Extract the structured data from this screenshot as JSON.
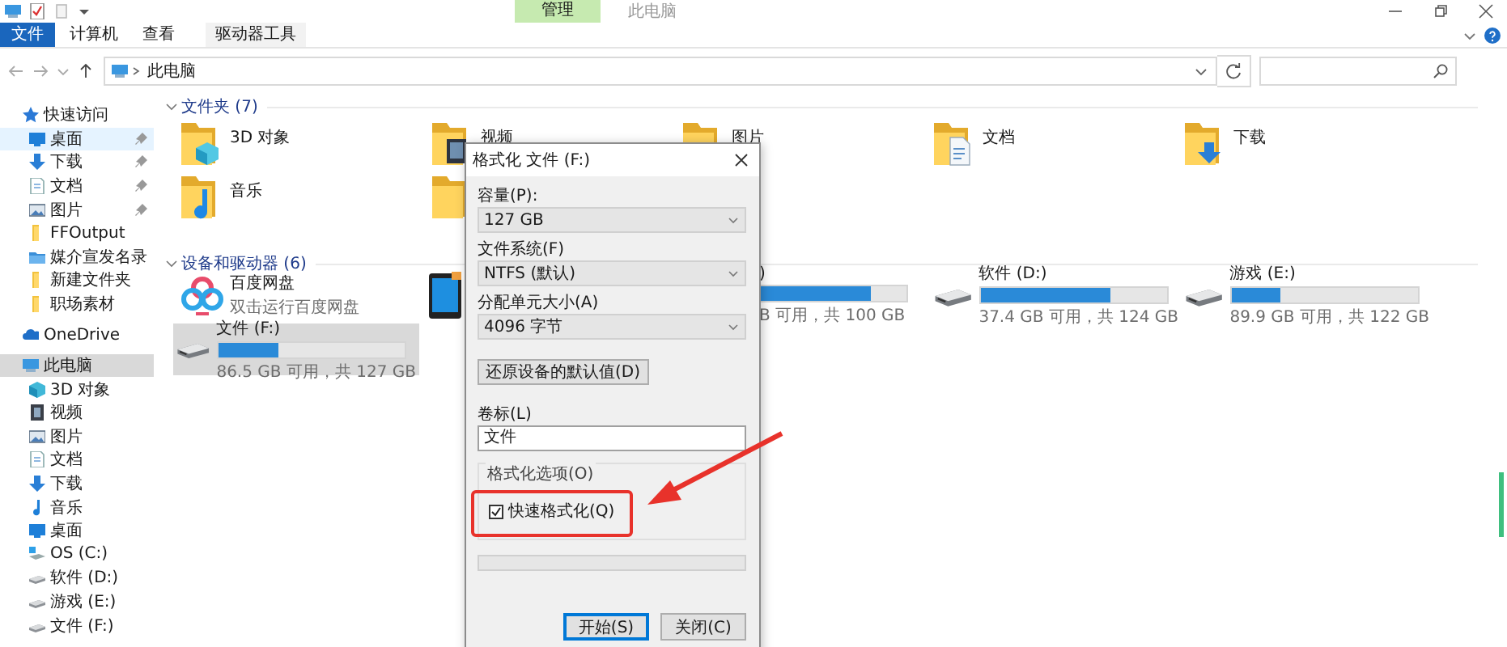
{
  "window": {
    "title": "此电脑",
    "context_tab": "管理"
  },
  "ribbon": {
    "tabs": [
      {
        "label": "文件",
        "selected": true
      },
      {
        "label": "计算机",
        "selected": false
      },
      {
        "label": "查看",
        "selected": false
      },
      {
        "label": "驱动器工具",
        "selected": false
      }
    ]
  },
  "address_bar": {
    "path": "此电脑"
  },
  "sidebar": {
    "items": [
      {
        "label": "快速访问",
        "kind": "star",
        "selected": false,
        "children": [
          {
            "label": "桌面",
            "kind": "desktop",
            "selected": true,
            "pinned": true
          },
          {
            "label": "下载",
            "kind": "download",
            "selected": false,
            "pinned": true
          },
          {
            "label": "文档",
            "kind": "document",
            "selected": false,
            "pinned": true
          },
          {
            "label": "图片",
            "kind": "picture",
            "selected": false,
            "pinned": true
          },
          {
            "label": "FFOutput",
            "kind": "folder",
            "selected": false,
            "pinned": false
          },
          {
            "label": "媒介宣发名录",
            "kind": "media",
            "selected": false,
            "pinned": false
          },
          {
            "label": "新建文件夹",
            "kind": "folder",
            "selected": false,
            "pinned": false
          },
          {
            "label": "职场素材",
            "kind": "folder",
            "selected": false,
            "pinned": false
          }
        ]
      },
      {
        "label": "OneDrive",
        "kind": "cloud",
        "selected": false
      },
      {
        "label": "此电脑",
        "kind": "pc",
        "selected": true,
        "children": [
          {
            "label": "3D 对象",
            "kind": "cube",
            "selected": false
          },
          {
            "label": "视频",
            "kind": "video",
            "selected": false
          },
          {
            "label": "图片",
            "kind": "picture",
            "selected": false
          },
          {
            "label": "文档",
            "kind": "document",
            "selected": false
          },
          {
            "label": "下载",
            "kind": "download",
            "selected": false
          },
          {
            "label": "音乐",
            "kind": "music",
            "selected": false
          },
          {
            "label": "桌面",
            "kind": "desktop",
            "selected": false
          },
          {
            "label": "OS (C:)",
            "kind": "os",
            "selected": false
          },
          {
            "label": "软件 (D:)",
            "kind": "drive",
            "selected": false
          },
          {
            "label": "游戏 (E:)",
            "kind": "drive",
            "selected": false
          },
          {
            "label": "文件 (F:)",
            "kind": "drive",
            "selected": false
          }
        ]
      }
    ]
  },
  "folders": {
    "title": "文件夹 (7)",
    "items": [
      {
        "name": "3D 对象",
        "kind": "cube"
      },
      {
        "name": "视频",
        "kind": "video"
      },
      {
        "name": "图片",
        "kind": "picture"
      },
      {
        "name": "文档",
        "kind": "document"
      },
      {
        "name": "下载",
        "kind": "download"
      },
      {
        "name": "音乐",
        "kind": "music"
      },
      {
        "kind": "desktop"
      }
    ]
  },
  "devices": {
    "title": "设备和驱动器 (6)",
    "items": [
      {
        "kind": "app",
        "name": "百度网盘",
        "detail": "双击运行百度网盘",
        "selected": false
      },
      {
        "kind": "tablet",
        "selected": false
      },
      {
        "kind": "cut",
        "name": ")",
        "detail": "B 可用，共 100 GB",
        "level": 0.76,
        "selected": false
      },
      {
        "kind": "drive",
        "name": "软件 (D:)",
        "detail": "37.4 GB 可用，共 124 GB",
        "level": 0.7,
        "selected": false
      },
      {
        "kind": "drive",
        "name": "游戏 (E:)",
        "detail": "89.9 GB 可用，共 122 GB",
        "level": 0.26,
        "selected": false
      },
      {
        "kind": "drive",
        "name": "文件 (F:)",
        "detail": "86.5 GB 可用，共 127 GB",
        "level": 0.32,
        "selected": true
      }
    ]
  },
  "dialog": {
    "title": "格式化 文件 (F:)",
    "fields": [
      {
        "kind": "select",
        "label": "容量(P):",
        "value": "127 GB"
      },
      {
        "kind": "select",
        "label": "文件系统(F)",
        "value": "NTFS (默认)"
      },
      {
        "kind": "select",
        "label": "分配单元大小(A)",
        "value": "4096 字节"
      },
      {
        "kind": "button",
        "label": "还原设备的默认值(D)"
      },
      {
        "kind": "input",
        "label": "卷标(L)",
        "value": "文件"
      },
      {
        "kind": "group",
        "label": "格式化选项(O)",
        "options": [
          {
            "label": "快速格式化(Q)",
            "checked": true
          }
        ]
      },
      {
        "kind": "progress",
        "level": 0
      }
    ],
    "buttons": [
      {
        "label": "开始(S)",
        "default": true
      },
      {
        "label": "关闭(C)",
        "default": false
      }
    ]
  }
}
